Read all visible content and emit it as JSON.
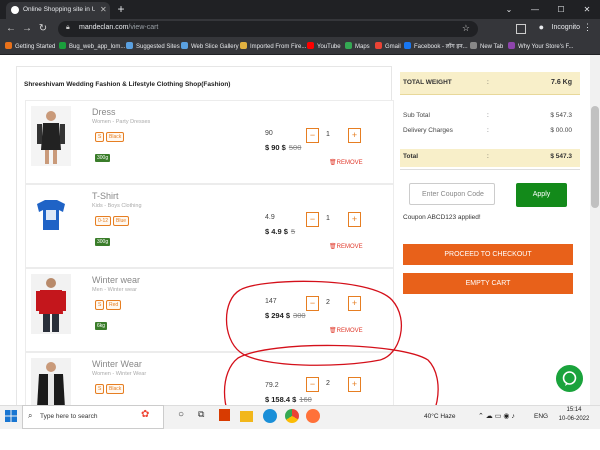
{
  "browser": {
    "tab_title": "Online Shopping site in US: Shop",
    "url_domain": "mandeclan.com",
    "url_path": "/view-cart",
    "profile_label": "Incognito"
  },
  "bookmarks": [
    {
      "label": "Getting Started",
      "color": "#e8711a"
    },
    {
      "label": "Bug_web_app_lom...",
      "color": "#1a9f3c"
    },
    {
      "label": "Suggested Sites",
      "color": "#5aa0e0"
    },
    {
      "label": "Web Slice Gallery",
      "color": "#5aa0e0"
    },
    {
      "label": "Imported From Fire...",
      "color": "#e0b040"
    },
    {
      "label": "YouTube",
      "color": "#ff0000"
    },
    {
      "label": "Maps",
      "color": "#34a853"
    },
    {
      "label": "Gmail",
      "color": "#ea4335"
    },
    {
      "label": "Facebook - लॉग इन...",
      "color": "#1877f2"
    },
    {
      "label": "New Tab",
      "color": "#888888"
    },
    {
      "label": "Why Your Store's F...",
      "color": "#8e44ad"
    }
  ],
  "cart": {
    "shop_name": "Shreeshivam Wedding Fashion & Lifestyle Clothing Shop(Fashion)",
    "items": [
      {
        "name": "Dress",
        "category": "Women - Party Dresses",
        "size": "S",
        "color": "Black",
        "weight": "300g",
        "unit_price": "90",
        "price": "$ 90 $",
        "old_price": "500",
        "qty": "1",
        "remove": "REMOVE"
      },
      {
        "name": "T-Shirt",
        "category": "Kids - Boys Clothing",
        "size": "0-12",
        "color": "Blue",
        "weight": "300g",
        "unit_price": "4.9",
        "price": "$ 4.9 $",
        "old_price": "5",
        "qty": "1",
        "remove": "REMOVE"
      },
      {
        "name": "Winter wear",
        "category": "Men - Winter wear",
        "size": "S",
        "color": "Red",
        "weight": "6kg",
        "unit_price": "147",
        "price": "$ 294 $",
        "old_price": "300",
        "qty": "2",
        "remove": "REMOVE"
      },
      {
        "name": "Winter Wear",
        "category": "Women - Winter Wear",
        "size": "S",
        "color": "Black",
        "weight": "",
        "unit_price": "79.2",
        "price": "$ 158.4 $",
        "old_price": "160",
        "qty": "2",
        "remove": ""
      }
    ]
  },
  "summary": {
    "total_weight_label": "TOTAL WEIGHT",
    "total_weight_value": "7.6 Kg",
    "colon": ":",
    "subtotal_label": "Sub Total",
    "subtotal_value": "$ 547.3",
    "delivery_label": "Delivery Charges",
    "delivery_value": "$ 00.00",
    "total_label": "Total",
    "total_value": "$ 547.3",
    "coupon_placeholder": "Enter Coupon Code",
    "apply_label": "Apply",
    "coupon_message": "Coupon ABCD123 applied!",
    "checkout_label": "PROCEED TO CHECKOUT",
    "empty_label": "EMPTY CART"
  },
  "taskbar": {
    "search_placeholder": "Type here to search",
    "weather": "40°C  Haze",
    "language": "ENG",
    "time": "15:14",
    "date": "10-06-2022"
  }
}
